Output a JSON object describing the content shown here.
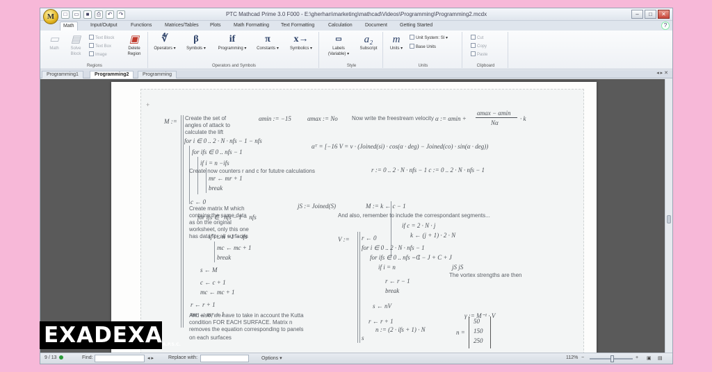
{
  "app": {
    "title": "PTC Mathcad Prime 3.0 F000 - E:\\gherhan\\marketing\\mathcad\\Videos\\Programming\\Programming2.mcdx",
    "logo": "M"
  },
  "ribbon_tabs": [
    "Math",
    "Input/Output",
    "Functions",
    "Matrices/Tables",
    "Plots",
    "Math Formatting",
    "Text Formatting",
    "Calculation",
    "Document",
    "Getting Started"
  ],
  "ribbon": {
    "regions": {
      "label": "Regions",
      "math": "Math",
      "solve_block": "Solve Block",
      "text_block": "Text Block",
      "text_box": "Text Box",
      "image": "Image",
      "delete_region": "Delete Region"
    },
    "operators": {
      "label": "Operators and Symbols",
      "operators": "Operators",
      "symbols": "Symbols",
      "programming": "Programming",
      "constants": "Constants",
      "symbolics": "Symbolics"
    },
    "style": {
      "label": "Style",
      "labels": "Labels",
      "labels_value": "(Variable)",
      "subscript": "Subscript"
    },
    "units": {
      "label": "Units",
      "units": "Units",
      "unit_system": "Unit System:",
      "unit_system_value": "SI",
      "base_units": "Base Units"
    },
    "clipboard": {
      "label": "Clipboard",
      "cut": "Cut",
      "copy": "Copy",
      "paste": "Paste"
    }
  },
  "doc_tabs": [
    "Programming1",
    "Programming2",
    "Programming"
  ],
  "worksheet": {
    "M_label": "M :=",
    "text_create_set": "Create the set of",
    "text_angles": "angles of attack to",
    "text_calc_lift": "calculate the lift",
    "amin": "αmin := −15",
    "amax": "αmax := No",
    "text_now_freestream": "Now write the freestream velocity",
    "alpha_k": "α  := αmin +",
    "frac_num": "αmax − αmin",
    "frac_den": "Nα",
    "frac_k": "· k",
    "for_i": "for i ∈ 0 .. 2 · N · nfs − 1 − nfs",
    "for_ifs": "for ifs ∈ 0 .. nfs − 1",
    "if_i": "if i = n    −ifs",
    "vinf": "αᵀ = [−16  V  = v  · (Joined(si)  · cos(α  · deg) − Joined(co)  · sin(α  · deg))",
    "mr": "mr ← mr + 1",
    "brk1": "break",
    "text_counters": "Create now counters r and c for fututre calculations",
    "r_range": "r := 0 .. 2 · N · nfs − 1    c := 0 .. 2 · N · nfs − 1",
    "c0": "c ← 0",
    "text_matrix": "Create matrix M which",
    "text_same_data": "contains the same data",
    "text_original": "as on the original",
    "text_worksheet": "worksheet, only this one",
    "text_has_data": "has data for all surfaces",
    "nfs_line": "for ifs ∈  · nfs − 1 − nfs",
    "if_line": "if i ≤ n   +1 − ifs",
    "mc": "mc ← mc + 1",
    "brk2": "break",
    "jS": "jS := Joined(S)",
    "M_rc": "M    := k ← c − 1",
    "text_remember": "And also, remember to include the correspondant segments...",
    "if_c": "if c = 2 · N · j",
    "k_line": "k ← (j + 1) · 2 · N",
    "s_line": "s ← M",
    "c_inc": "c ← c + 1",
    "mc_inc": "mc ← mc + 1",
    "Vp": "V    :=",
    "r0": "r ← 0",
    "for_i2": "for i ∈ 0 .. 2 · N · nfs − 1",
    "for_ifs2": "for ifs ∈ 0 .. nfs − 1",
    "if_n": "if i = n",
    "C_expr": "−C    −   J   + C    +   J",
    "jS_expr": "jS          jS",
    "text_vortex": "The vortex strengths are then",
    "r_dec": "r ← r − 1",
    "brk3": "break",
    "r_inc": "r ← r + 1",
    "mr2": "mr ← mr + 1",
    "s_nV": "s  ← nV",
    "r_inc2": "r ← r + 1",
    "n_expr": "n   := (2 · ifs + 1) · N",
    "gamma": "γ := M⁻¹ · V",
    "n_vec_label": "n =",
    "n_vec": [
      "50",
      "150",
      "250"
    ],
    "text_kutta1": "And also, we have to take in account the Kutta",
    "text_kutta2": "condition FOR EACH SURFACE. Matrix n",
    "text_kutta3": "removes the equation corresponding to panels",
    "text_kutta4": "on each surfaces",
    "s_final": "s"
  },
  "status": {
    "page": "9 / 13",
    "find": "Find:",
    "replace": "Replace with:",
    "options": "Options",
    "zoom": "112%"
  },
  "watermark": {
    "text": "EXADEXA",
    "small": "A.P.S.C."
  },
  "colors": {
    "background": "#f7b8d8",
    "status_ok": "#2c9a3a"
  }
}
